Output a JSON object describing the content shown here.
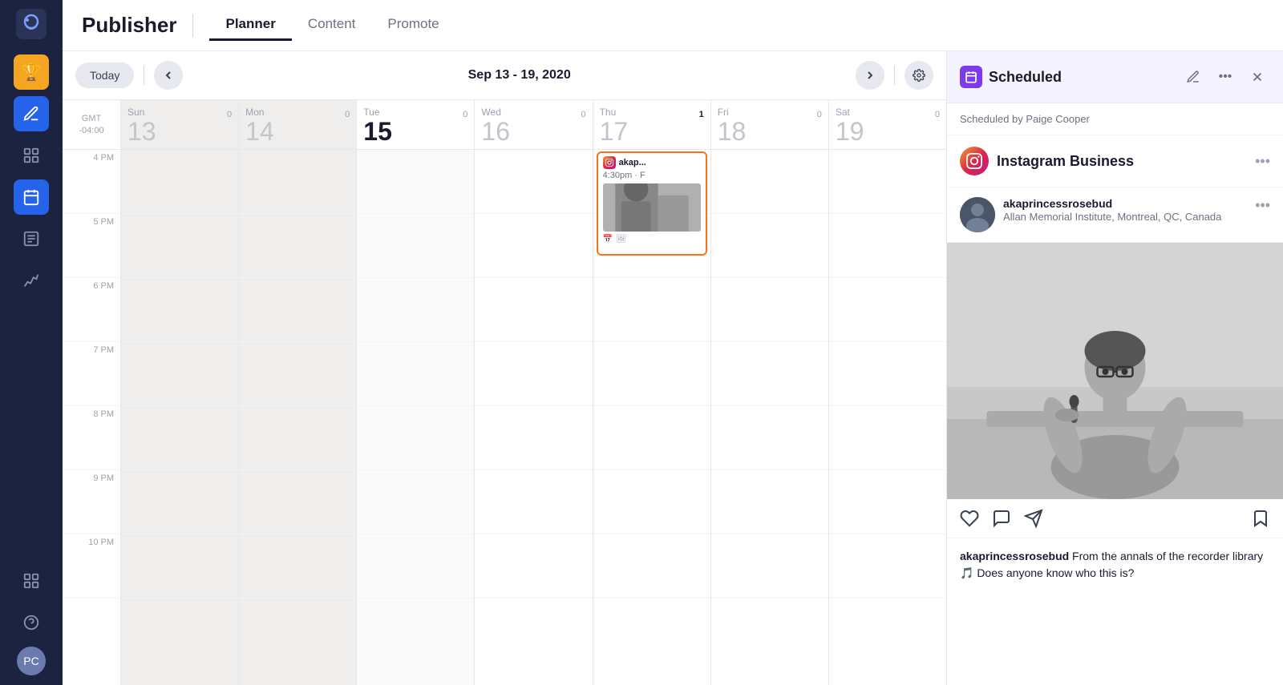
{
  "app": {
    "title": "Publisher",
    "logo_icon": "🦉"
  },
  "sidebar": {
    "items": [
      {
        "id": "trophy",
        "icon": "🏆",
        "active": "gold",
        "label": "Rewards"
      },
      {
        "id": "compose",
        "icon": "✏️",
        "active": "blue",
        "label": "Compose"
      },
      {
        "id": "dashboard",
        "icon": "⊞",
        "label": "Dashboard"
      },
      {
        "id": "calendar",
        "icon": "📅",
        "label": "Calendar",
        "active": "blue"
      },
      {
        "id": "tasks",
        "icon": "📋",
        "label": "Tasks"
      },
      {
        "id": "analytics",
        "icon": "📊",
        "label": "Analytics"
      }
    ],
    "bottom": [
      {
        "id": "grid",
        "icon": "⊞",
        "label": "Apps"
      },
      {
        "id": "help",
        "icon": "?",
        "label": "Help"
      }
    ],
    "avatar_label": "PC"
  },
  "nav": {
    "title": "Publisher",
    "tabs": [
      {
        "id": "planner",
        "label": "Planner",
        "active": true
      },
      {
        "id": "content",
        "label": "Content",
        "active": false
      },
      {
        "id": "promote",
        "label": "Promote",
        "active": false
      }
    ]
  },
  "toolbar": {
    "today_label": "Today",
    "date_range": "Sep 13 - 19, 2020",
    "gmt_label": "GMT\n-04:00"
  },
  "calendar": {
    "days": [
      {
        "name": "Sun",
        "num": "13",
        "count": "0",
        "today": false,
        "shaded": true
      },
      {
        "name": "Mon",
        "num": "14",
        "count": "0",
        "today": false,
        "shaded": true
      },
      {
        "name": "Tue",
        "num": "15",
        "count": "0",
        "today": true,
        "shaded": false
      },
      {
        "name": "Wed",
        "num": "16",
        "count": "0",
        "today": false,
        "shaded": false
      },
      {
        "name": "Thu",
        "num": "17",
        "count": "1",
        "today": false,
        "shaded": false
      },
      {
        "name": "Fri",
        "num": "18",
        "count": "0",
        "today": false,
        "shaded": false
      },
      {
        "name": "Sat",
        "num": "19",
        "count": "0",
        "today": false,
        "shaded": false
      }
    ],
    "time_slots": [
      "4 PM",
      "5 PM",
      "6 PM",
      "7 PM",
      "8 PM",
      "9 PM",
      "10 PM"
    ],
    "event": {
      "username": "akap...",
      "full_username": "akaprincessrosebud",
      "time": "4:30pm · F",
      "day_index": 4,
      "slot_index": 0
    }
  },
  "panel": {
    "title": "Scheduled",
    "scheduled_by": "Scheduled by Paige Cooper",
    "platform": "Instagram Business",
    "account": {
      "username": "akaprincessrosebud",
      "location": "Allan Memorial Institute, Montreal, QC,\nCanada"
    },
    "caption_username": "akaprincessrosebud",
    "caption_text": " From the annals of the recorder library 🎵\nDoes anyone know who this is?"
  }
}
